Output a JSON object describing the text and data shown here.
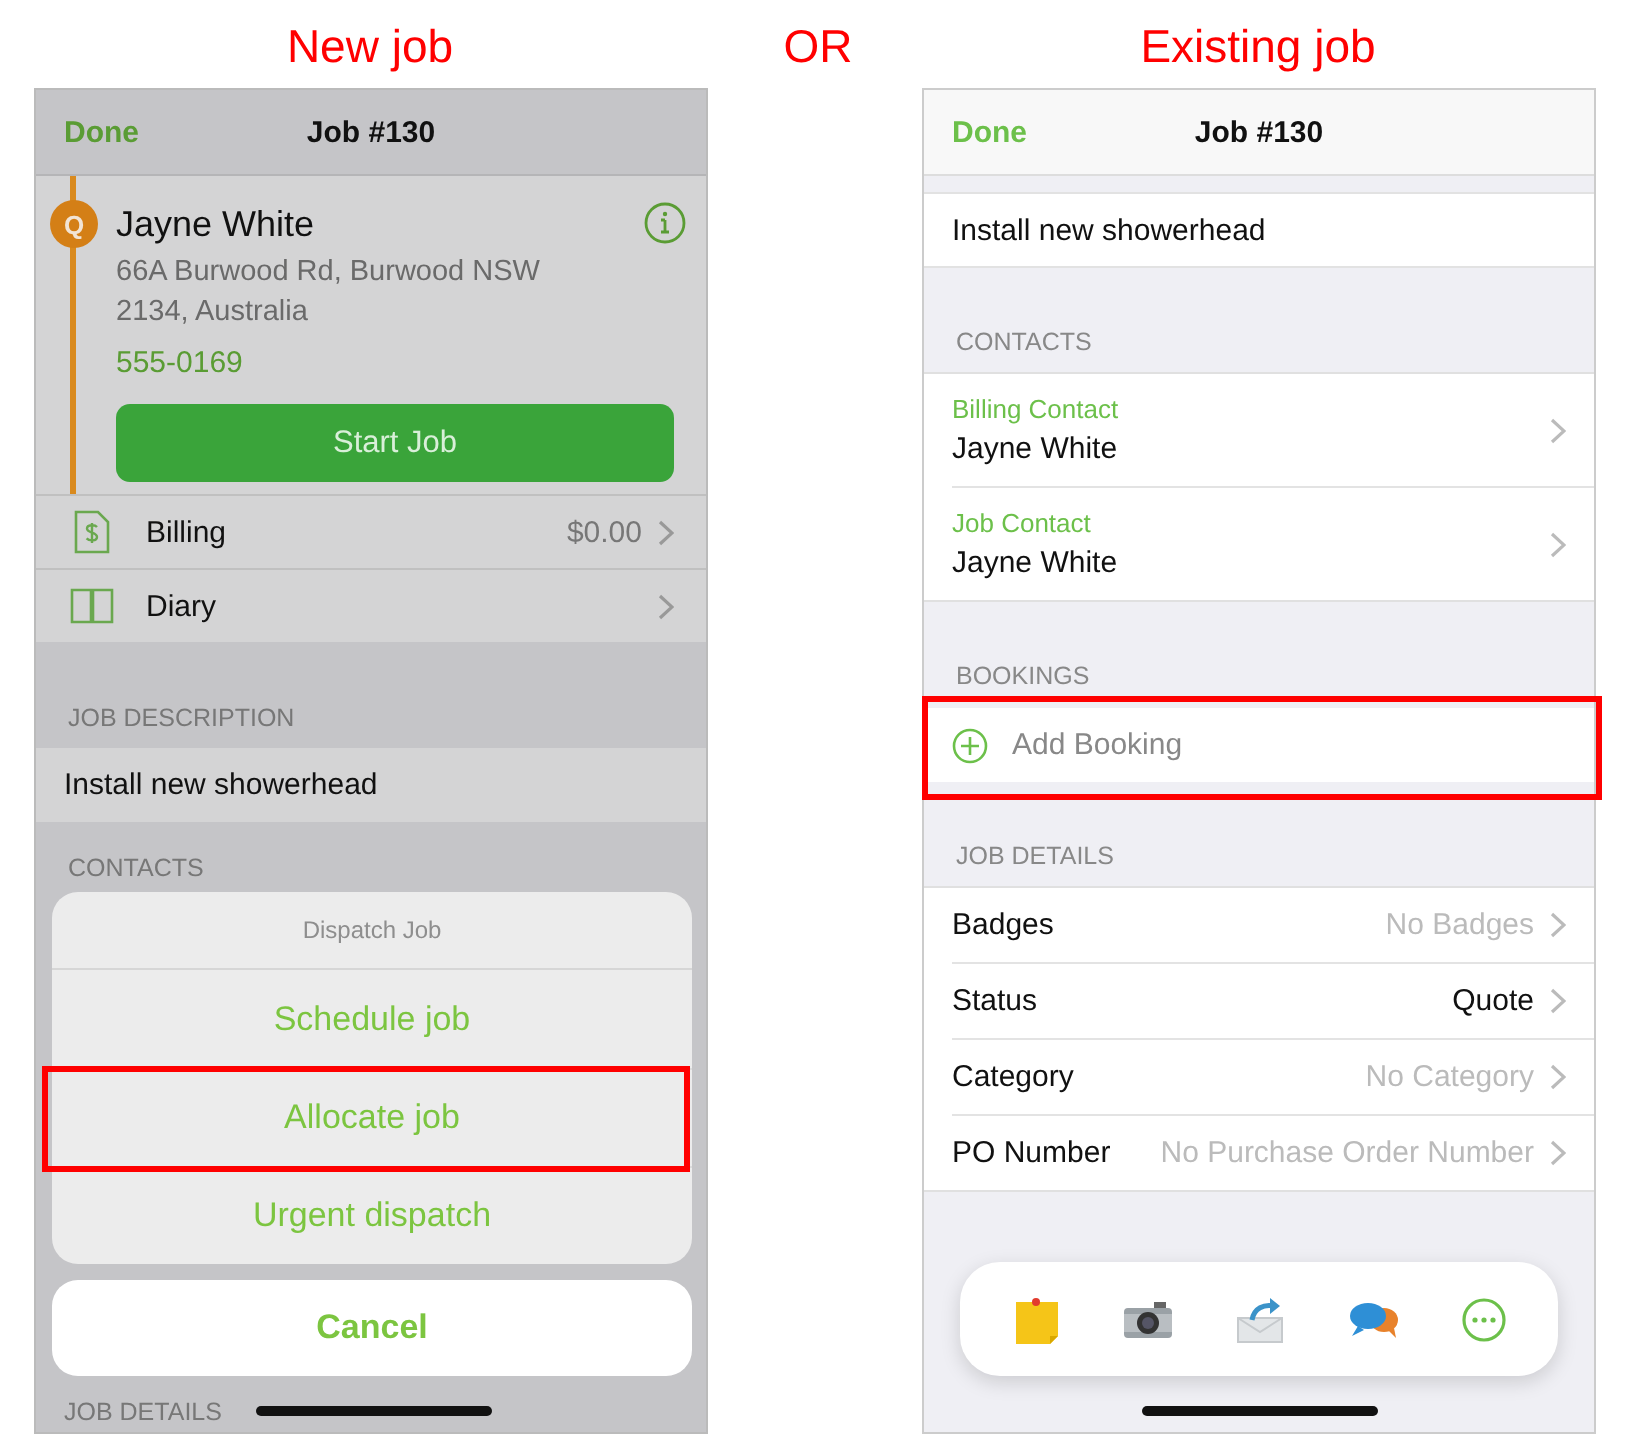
{
  "captions": [
    {
      "text": "New job"
    },
    {
      "text": "OR"
    },
    {
      "text": "Existing job"
    }
  ],
  "new_job": {
    "nav": {
      "done": "Done",
      "title": "Job #130"
    },
    "client": {
      "badge": "Q",
      "name": "Jayne White",
      "address": "66A Burwood Rd, Burwood NSW 2134, Australia",
      "phone": "555-0169",
      "start_button": "Start Job"
    },
    "rows": [
      {
        "kind": "billing",
        "label": "Billing",
        "value": "$0.00"
      },
      {
        "kind": "diary",
        "label": "Diary"
      }
    ],
    "description_header": "JOB DESCRIPTION",
    "description": "Install new showerhead",
    "contacts_header": "CONTACTS",
    "details_header": "JOB DETAILS",
    "action_sheet": {
      "title": "Dispatch Job",
      "options": [
        {
          "label": "Schedule job",
          "highlighted": false
        },
        {
          "label": "Allocate job",
          "highlighted": true
        },
        {
          "label": "Urgent dispatch",
          "highlighted": false
        }
      ],
      "cancel": "Cancel"
    }
  },
  "existing_job": {
    "nav": {
      "done": "Done",
      "title": "Job #130"
    },
    "description": "Install new showerhead",
    "contacts_header": "CONTACTS",
    "contacts": [
      {
        "role": "Billing Contact",
        "name": "Jayne White"
      },
      {
        "role": "Job Contact",
        "name": "Jayne White"
      }
    ],
    "bookings_header": "BOOKINGS",
    "add_booking": {
      "label": "Add Booking",
      "highlighted": true
    },
    "details_header": "JOB DETAILS",
    "details": [
      {
        "label": "Badges",
        "value": "No Badges",
        "empty": true
      },
      {
        "label": "Status",
        "value": "Quote",
        "empty": false
      },
      {
        "label": "Category",
        "value": "No Category",
        "empty": true
      },
      {
        "label": "PO Number",
        "value": "No Purchase Order Number",
        "empty": true
      }
    ],
    "toolbar": [
      {
        "kind": "note"
      },
      {
        "kind": "camera"
      },
      {
        "kind": "email"
      },
      {
        "kind": "chat"
      },
      {
        "kind": "more"
      }
    ]
  }
}
